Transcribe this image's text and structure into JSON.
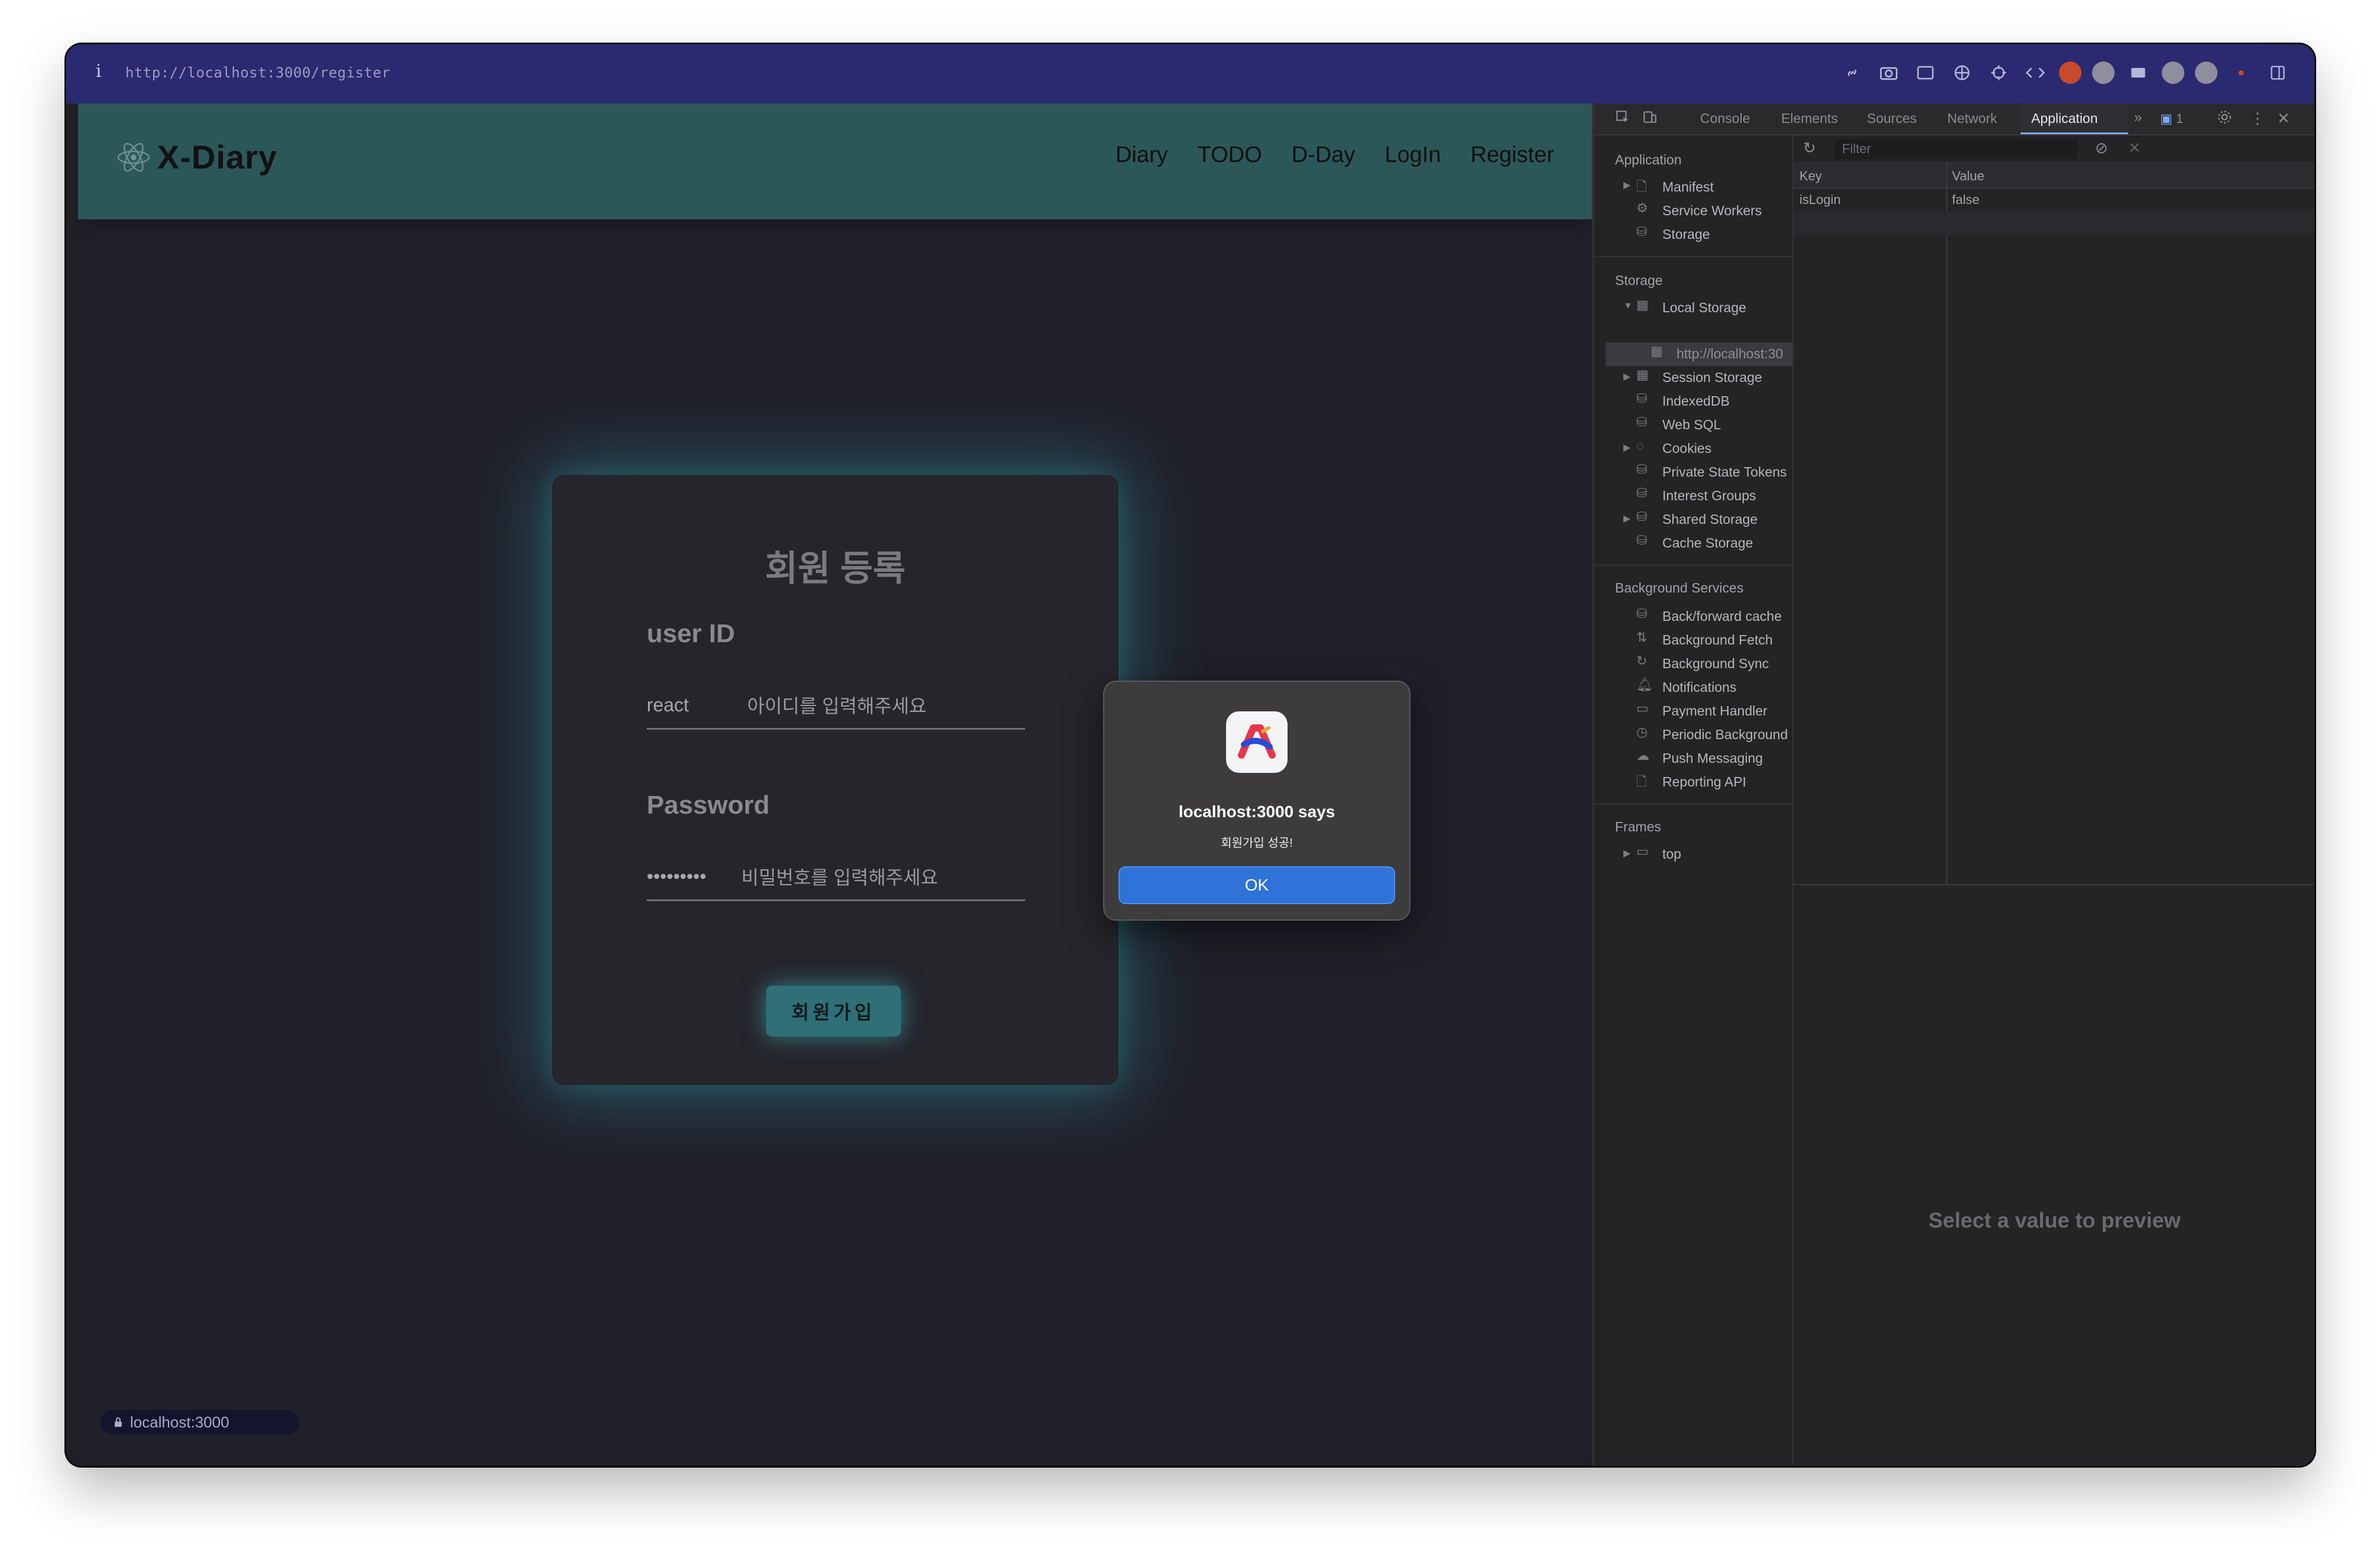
{
  "browser": {
    "url": "http://localhost:3000/register",
    "info_glyph": "i",
    "status_url": "localhost:3000"
  },
  "app": {
    "brand": "X-Diary",
    "nav": [
      "Diary",
      "TODO",
      "D-Day",
      "LogIn",
      "Register"
    ]
  },
  "form": {
    "title": "회원 등록",
    "userid_label": "user ID",
    "userid_value": "react",
    "userid_placeholder": "아이디를 입력해주세요",
    "password_label": "Password",
    "password_value": "•••••••••",
    "password_placeholder": "비밀번호를 입력해주세요",
    "submit_label": "회원가입"
  },
  "dialog": {
    "title": "localhost:3000 says",
    "message": "회원가입 성공!",
    "ok_label": "OK"
  },
  "devtools": {
    "tabs": [
      "Console",
      "Elements",
      "Sources",
      "Network",
      "Application"
    ],
    "active_tab": "Application",
    "issues_count": "1",
    "sections": {
      "application": {
        "heading": "Application",
        "items": [
          "Manifest",
          "Service Workers",
          "Storage"
        ]
      },
      "storage": {
        "heading": "Storage",
        "items": [
          "Local Storage",
          "http://localhost:30",
          "Session Storage",
          "IndexedDB",
          "Web SQL",
          "Cookies",
          "Private State Tokens",
          "Interest Groups",
          "Shared Storage",
          "Cache Storage"
        ]
      },
      "background": {
        "heading": "Background Services",
        "items": [
          "Back/forward cache",
          "Background Fetch",
          "Background Sync",
          "Notifications",
          "Payment Handler",
          "Periodic Background",
          "Push Messaging",
          "Reporting API"
        ]
      },
      "frames": {
        "heading": "Frames",
        "items": [
          "top"
        ]
      }
    },
    "filter_placeholder": "Filter",
    "table": {
      "headers": [
        "Key",
        "Value"
      ],
      "rows": [
        [
          "isLogin",
          "false"
        ]
      ]
    },
    "preview_text": "Select a value to preview"
  },
  "colors": {
    "toolbar": "#2b2a70",
    "nav": "#2c5759",
    "page_bg": "#20202b",
    "accent_button": "#2f6f77",
    "dialog_ok": "#2f73d8"
  }
}
